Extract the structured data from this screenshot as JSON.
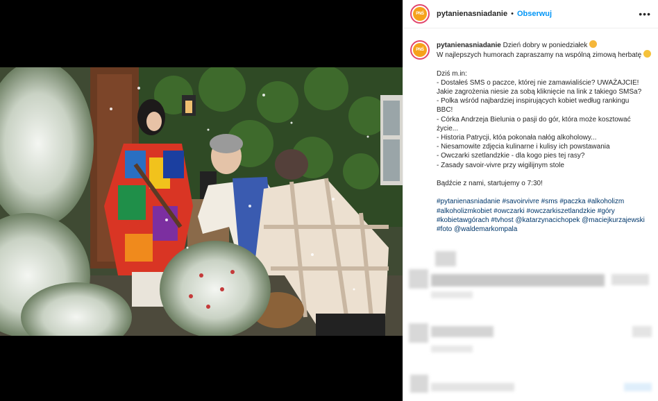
{
  "header": {
    "username": "pytanienasniadanie",
    "separator": "•",
    "follow_label": "Obserwuj",
    "more_label": "•••",
    "avatar_text": "PNŚ"
  },
  "caption": {
    "username": "pytanienasniadanie",
    "lines": [
      "Dzień dobry w poniedziałek",
      "W najlepszych humorach zapraszamy na wspólną zimową herbatę",
      "Dziś m.in:",
      "- Dostałeś SMS o paczce, której nie zamawialiście? UWAŻAJCIE!",
      "Jakie zagrożenia niesie za sobą kliknięcie na link z takiego SMSa?",
      "- Polka wśród najbardziej inspirujących kobiet według rankingu",
      "BBC!",
      "- Córka Andrzeja Bielunia o pasji do gór, która może kosztować",
      "życie...",
      "- Historia Patrycji, któa pokonała nałóg alkoholowy...",
      "- Niesamowite zdjęcia kulinarne i kulisy ich powstawania",
      "- Owczarki szetlandzkie - dla kogo pies tej rasy?",
      "- Zasady savoir-vivre przy wigilijnym stole",
      "Bądźcie z nami, startujemy o 7:30!",
      "#pytanienasniadanie #savoirvivre #sms #paczka #alkoholizm",
      "#alkoholizmkobiet #owczarki #owczarkiszetlandzkie #góry",
      "#kobietawgórach #tvhost @katarzynacichopek @maciejkurzajewski",
      "#foto @waldemarkompala"
    ]
  },
  "colors": {
    "accent": "#0095f6",
    "hashtag": "#00376b",
    "text": "#262626",
    "avatar_ring": "#e2466c",
    "avatar_fill": "#f6a21b"
  }
}
